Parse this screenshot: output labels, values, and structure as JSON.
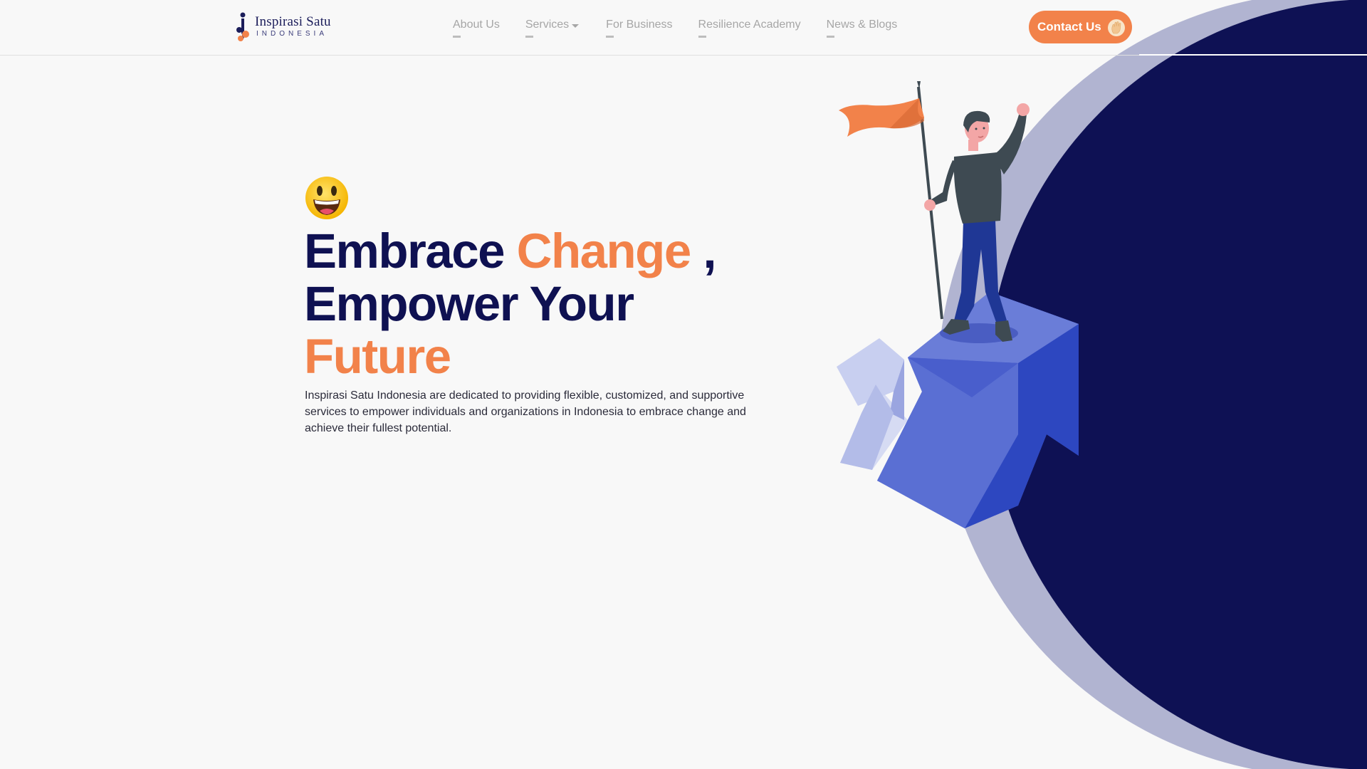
{
  "brand": {
    "name": "Inspirasi Satu",
    "subtitle": "INDONESIA",
    "primary_color": "#0f1152",
    "accent_color": "#f2824a"
  },
  "nav": {
    "items": [
      {
        "label": "About Us",
        "has_dropdown": false
      },
      {
        "label": "Services",
        "has_dropdown": true
      },
      {
        "label": "For Business",
        "has_dropdown": false
      },
      {
        "label": "Resilience Academy",
        "has_dropdown": false
      },
      {
        "label": "News & Blogs",
        "has_dropdown": false
      }
    ],
    "cta_label": "Contact Us",
    "cta_icon": "waving-hand-icon"
  },
  "hero": {
    "emoji_icon": "smiling-face-icon",
    "title_part1": "Embrace ",
    "title_accent1": "Change",
    "title_comma": " ,",
    "title_part2": "Empower Your",
    "title_accent2": "Future",
    "description": "Inspirasi Satu Indonesia are dedicated to providing flexible, customized, and supportive services to empower individuals and organizations in Indonesia to embrace change and achieve their fullest potential.",
    "illustration_icon": "person-with-flag-on-arrow-illustration"
  }
}
